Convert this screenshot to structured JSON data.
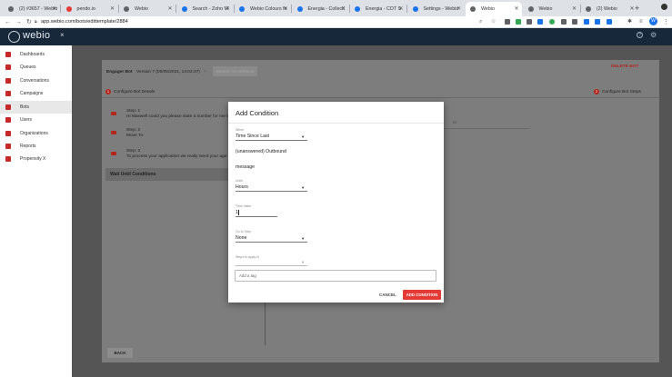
{
  "browser": {
    "tabs": [
      {
        "label": "(2) #3657 - Webio",
        "fav_color": "#5f6368"
      },
      {
        "label": "pendo.io",
        "fav_color": "#e53935"
      },
      {
        "label": "Webio",
        "fav_color": "#5f6368"
      },
      {
        "label": "Search - Zoho M",
        "fav_color": "#1a73e8"
      },
      {
        "label": "Webio Colours fo",
        "fav_color": "#1a73e8"
      },
      {
        "label": "Energia - Collecti",
        "fav_color": "#1a73e8"
      },
      {
        "label": "Energia - COT S",
        "fav_color": "#1a73e8"
      },
      {
        "label": "Settings - Webio",
        "fav_color": "#1a73e8"
      },
      {
        "label": "Webio",
        "fav_color": "#5f6368"
      },
      {
        "label": "Webio",
        "fav_color": "#5f6368"
      },
      {
        "label": "(2) Webio",
        "fav_color": "#5f6368"
      }
    ],
    "new_tab": "+",
    "url": "app.webio.com/bots/edittemplate/2884",
    "profile_initial": "W"
  },
  "app": {
    "logo": "webio",
    "close": "×"
  },
  "sidebar": {
    "items": [
      {
        "label": "Dashboards",
        "icon": "dashboard-icon"
      },
      {
        "label": "Queues",
        "icon": "queue-icon"
      },
      {
        "label": "Conversations",
        "icon": "conversation-icon"
      },
      {
        "label": "Campaigns",
        "icon": "campaign-icon"
      },
      {
        "label": "Bots",
        "icon": "bot-icon"
      },
      {
        "label": "Users",
        "icon": "users-icon"
      },
      {
        "label": "Organizations",
        "icon": "organization-icon"
      },
      {
        "label": "Reports",
        "icon": "chart-icon"
      },
      {
        "label": "Propensity X",
        "icon": "propensity-icon"
      }
    ],
    "active_index": 4
  },
  "page": {
    "bot_name": "Engager Bot",
    "version": "Version 7 (05/05/2021, 14:02:27)",
    "revert_button": "REVERT TO VERSION",
    "delete_bot": "DELETE BOT",
    "configure_details_num": "1",
    "configure_details": "Configure Bot Details",
    "configure_steps_num": "2",
    "configure_steps": "Configure Bot Steps",
    "steps": [
      {
        "title": "Step: 1",
        "desc": "Hi Maxwell could you please state a number for me that w"
      },
      {
        "title": "Step: 2",
        "desc": "Move To:"
      },
      {
        "title": "Step: 3",
        "desc": "To process your application we really need your age or you"
      }
    ],
    "wait_until": "Wait Until Conditions",
    "right_snippet": "to",
    "back_button": "BACK"
  },
  "dialog": {
    "title": "Add Condition",
    "when_label": "When",
    "when_value": "Time Since Last",
    "unanswered_text": "(unanswered) Outbound",
    "message_text": "message",
    "units_label": "Units",
    "units_value": "Hours",
    "time_value_label": "Time Value",
    "time_value": "1",
    "goto_label": "Go to Step",
    "goto_value": "None",
    "steps_apply_label": "Steps to apply to",
    "steps_apply_value": "",
    "tag_placeholder": "Add a tag",
    "cancel_label": "CANCEL",
    "add_label": "ADD CONDITION"
  }
}
